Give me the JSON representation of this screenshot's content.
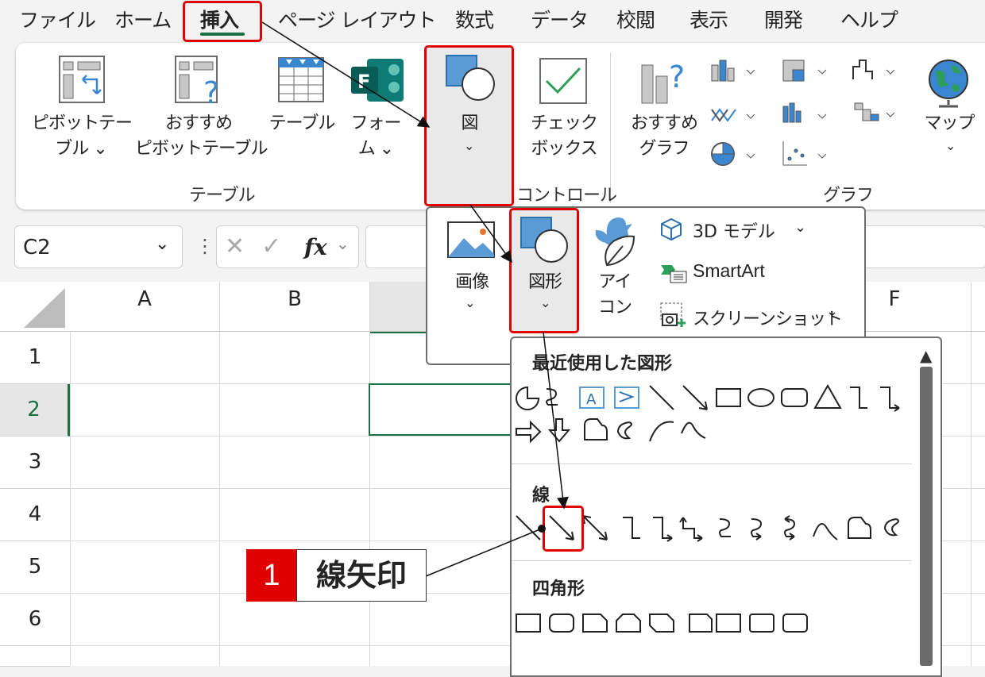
{
  "menu": {
    "items": [
      "ファイル",
      "ホーム",
      "挿入",
      "ページ レイアウト",
      "数式",
      "データ",
      "校閲",
      "表示",
      "開発",
      "ヘルプ"
    ],
    "active": "挿入"
  },
  "ribbon": {
    "pivot_l1": "ピボットテー",
    "pivot_l2": "ブル ⌄",
    "recpivot_l1": "おすすめ",
    "recpivot_l2": "ピボットテーブル",
    "table": "テーブル",
    "forms_l1": "フォー",
    "forms_l2": "ム ⌄",
    "illustrations": "図",
    "checkbox_l1": "チェック",
    "checkbox_l2": "ボックス",
    "recchart_l1": "おすすめ",
    "recchart_l2": "グラフ",
    "map": "マップ",
    "group_table": "テーブル",
    "group_control": "コントロール",
    "group_chart": "グラフ"
  },
  "formula_bar": {
    "name_box": "C2",
    "fx": "fx"
  },
  "sheet": {
    "columns": [
      "A",
      "B",
      "F"
    ],
    "rows": [
      "1",
      "2",
      "3",
      "4",
      "5",
      "6"
    ],
    "selected_row": "2"
  },
  "illustrations_menu": {
    "image": "画像",
    "shapes": "図形",
    "icon_l1": "アイ",
    "icon_l2": "コン",
    "model3d": "3D モデル",
    "smartart": "SmartArt",
    "screenshot": "スクリーンショット"
  },
  "shapes_gallery": {
    "recent": "最近使用した図形",
    "lines": "線",
    "rectangles": "四角形"
  },
  "callout": {
    "number": "1",
    "text": "線矢印"
  },
  "colors": {
    "accent_red": "#e00000",
    "excel_green": "#1e7145",
    "icon_blue": "#5b9bd5"
  }
}
